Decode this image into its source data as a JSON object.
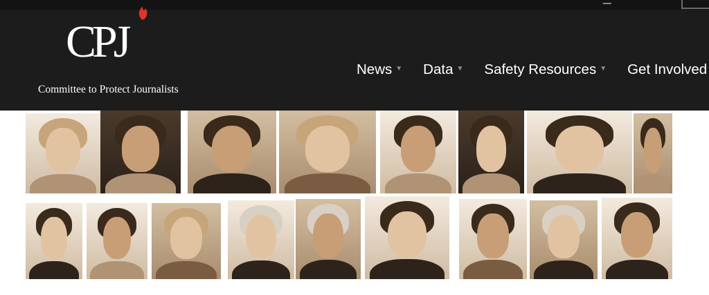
{
  "brand": {
    "logo_text": "CPJ",
    "tagline": "Committee to Protect Journalists",
    "accent_color": "#e0352b"
  },
  "nav": {
    "items": [
      {
        "label": "News",
        "caret_icon": "caret-down-icon"
      },
      {
        "label": "Data",
        "caret_icon": "caret-down-icon"
      },
      {
        "label": "Safety Resources",
        "caret_icon": "caret-down-icon"
      },
      {
        "label": "Get Involved",
        "caret_icon": "caret-down-icon"
      }
    ]
  },
  "caret_glyph": "▼",
  "colors": {
    "header_bg": "#1d1c1c",
    "photo_tone": "#a98c6e"
  }
}
